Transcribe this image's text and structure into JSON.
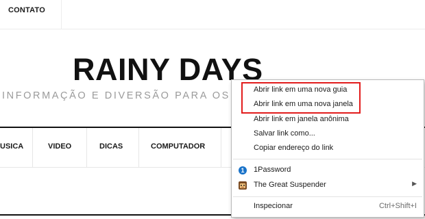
{
  "topnav": {
    "contact_label": "CONTATO"
  },
  "header": {
    "title": "RAINY DAYS",
    "tagline": "INFORMAÇÃO E DIVERSÃO PARA OS DI"
  },
  "mainnav": {
    "items": [
      {
        "label": "USICA"
      },
      {
        "label": "VIDEO"
      },
      {
        "label": "DICAS"
      },
      {
        "label": "COMPUTADOR"
      }
    ]
  },
  "context_menu": {
    "items": [
      {
        "label": "Abrir link em uma nova guia"
      },
      {
        "label": "Abrir link em uma nova janela"
      },
      {
        "label": "Abrir link em janela anônima"
      },
      {
        "label": "Salvar link como..."
      },
      {
        "label": "Copiar endereço do link"
      },
      {
        "label": "1Password",
        "icon": "onepassword-icon"
      },
      {
        "label": "The Great Suspender",
        "icon": "great-suspender-icon"
      },
      {
        "label": "Inspecionar",
        "shortcut": "Ctrl+Shift+I"
      }
    ],
    "highlight_color": "#e21b1b"
  }
}
